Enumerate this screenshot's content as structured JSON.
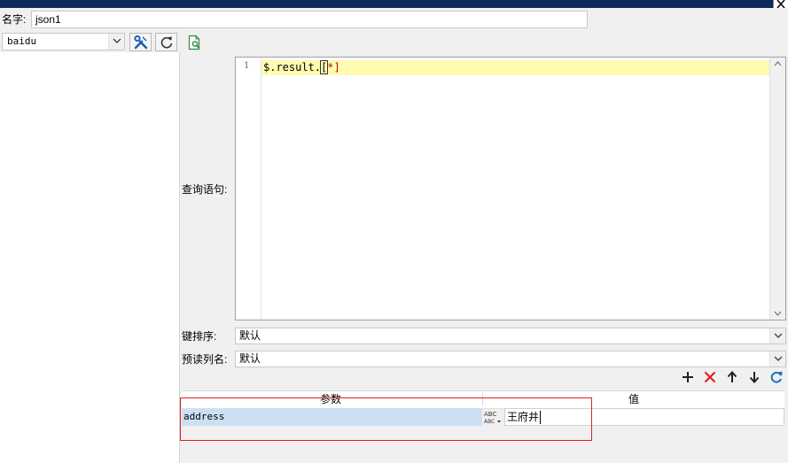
{
  "window": {
    "title_bar_color": "#0c2a5c"
  },
  "form": {
    "name_label": "名字:",
    "name_value": "json1",
    "datasource_value": "baidu",
    "query_label": "查询语句:",
    "key_sort_label": "键排序:",
    "key_sort_value": "默认",
    "preread_label": "预读列名:",
    "preread_value": "默认"
  },
  "editor": {
    "line_number": "1",
    "code_prefix": "$.result.",
    "code_bracket_open": "[",
    "code_star_bracket": "*]"
  },
  "params_table": {
    "headers": [
      "参数",
      "值"
    ],
    "rows": [
      {
        "param": "address",
        "value": "王府井"
      }
    ]
  },
  "icons": {
    "toolbar": [
      "settings-tools-icon",
      "refresh-icon",
      "preview-query-icon"
    ],
    "table_actions": [
      "add-icon",
      "delete-icon",
      "move-up-icon",
      "move-down-icon",
      "reload-icon"
    ],
    "type_icon": "abc-type-icon"
  },
  "colors": {
    "accent_blue": "#1a6fc4",
    "delete_red": "#e02020",
    "highlight_line": "#fffbb0",
    "selection": "#cce0f3"
  }
}
